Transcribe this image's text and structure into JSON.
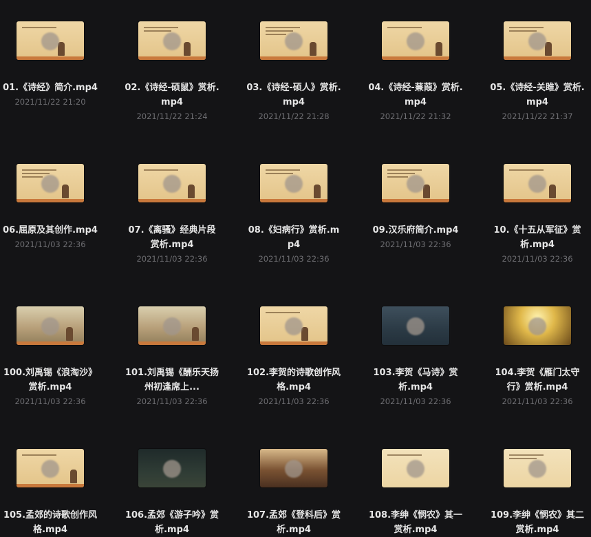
{
  "files": [
    {
      "name": "01.《诗经》简介.mp4",
      "date": "2021/11/22 21:20",
      "theme": "t-parch",
      "icon": "video-thumbnail"
    },
    {
      "name": "02.《诗经-硕鼠》赏析.mp4",
      "date": "2021/11/22 21:24",
      "theme": "t-parch",
      "icon": "video-thumbnail"
    },
    {
      "name": "03.《诗经-硕人》赏析.mp4",
      "date": "2021/11/22 21:28",
      "theme": "t-parch",
      "icon": "video-thumbnail"
    },
    {
      "name": "04.《诗经-蒹葭》赏析.mp4",
      "date": "2021/11/22 21:32",
      "theme": "t-parch",
      "icon": "video-thumbnail"
    },
    {
      "name": "05.《诗经-关雎》赏析.mp4",
      "date": "2021/11/22 21:37",
      "theme": "t-parch",
      "icon": "video-thumbnail"
    },
    {
      "name": "06.屈原及其创作.mp4",
      "date": "2021/11/03 22:36",
      "theme": "t-parch",
      "icon": "video-thumbnail"
    },
    {
      "name": "07.《离骚》经典片段赏析.mp4",
      "date": "2021/11/03 22:36",
      "theme": "t-parch",
      "icon": "video-thumbnail"
    },
    {
      "name": "08.《妇病行》赏析.mp4",
      "date": "2021/11/03 22:36",
      "theme": "t-parch",
      "icon": "video-thumbnail"
    },
    {
      "name": "09.汉乐府简介.mp4",
      "date": "2021/11/03 22:36",
      "theme": "t-parch",
      "icon": "video-thumbnail"
    },
    {
      "name": "10.《十五从军征》赏析.mp4",
      "date": "2021/11/03 22:36",
      "theme": "t-parch",
      "icon": "video-thumbnail"
    },
    {
      "name": "100.刘禹锡《浪淘沙》赏析.mp4",
      "date": "2021/11/03 22:36",
      "theme": "t-land",
      "icon": "video-thumbnail"
    },
    {
      "name": "101.刘禹锡《酬乐天扬州初逢席上...",
      "date": "2021/11/03 22:36",
      "theme": "t-land",
      "icon": "video-thumbnail"
    },
    {
      "name": "102.李贺的诗歌创作风格.mp4",
      "date": "2021/11/03 22:36",
      "theme": "t-parch",
      "icon": "video-thumbnail"
    },
    {
      "name": "103.李贺《马诗》赏析.mp4",
      "date": "2021/11/03 22:36",
      "theme": "t-night",
      "icon": "video-thumbnail"
    },
    {
      "name": "104.李贺《雁门太守行》赏析.mp4",
      "date": "2021/11/03 22:36",
      "theme": "t-gold",
      "icon": "video-thumbnail"
    },
    {
      "name": "105.孟郊的诗歌创作风格.mp4",
      "date": "",
      "theme": "t-parch",
      "icon": "video-thumbnail"
    },
    {
      "name": "106.孟郊《游子吟》赏析.mp4",
      "date": "",
      "theme": "t-cave",
      "icon": "video-thumbnail"
    },
    {
      "name": "107.孟郊《登科后》赏析.mp4",
      "date": "",
      "theme": "t-crowd",
      "icon": "video-thumbnail"
    },
    {
      "name": "108.李绅《悯农》其一赏析.mp4",
      "date": "",
      "theme": "t-plain",
      "icon": "video-thumbnail"
    },
    {
      "name": "109.李绅《悯农》其二赏析.mp4",
      "date": "",
      "theme": "t-plain",
      "icon": "video-thumbnail"
    }
  ]
}
